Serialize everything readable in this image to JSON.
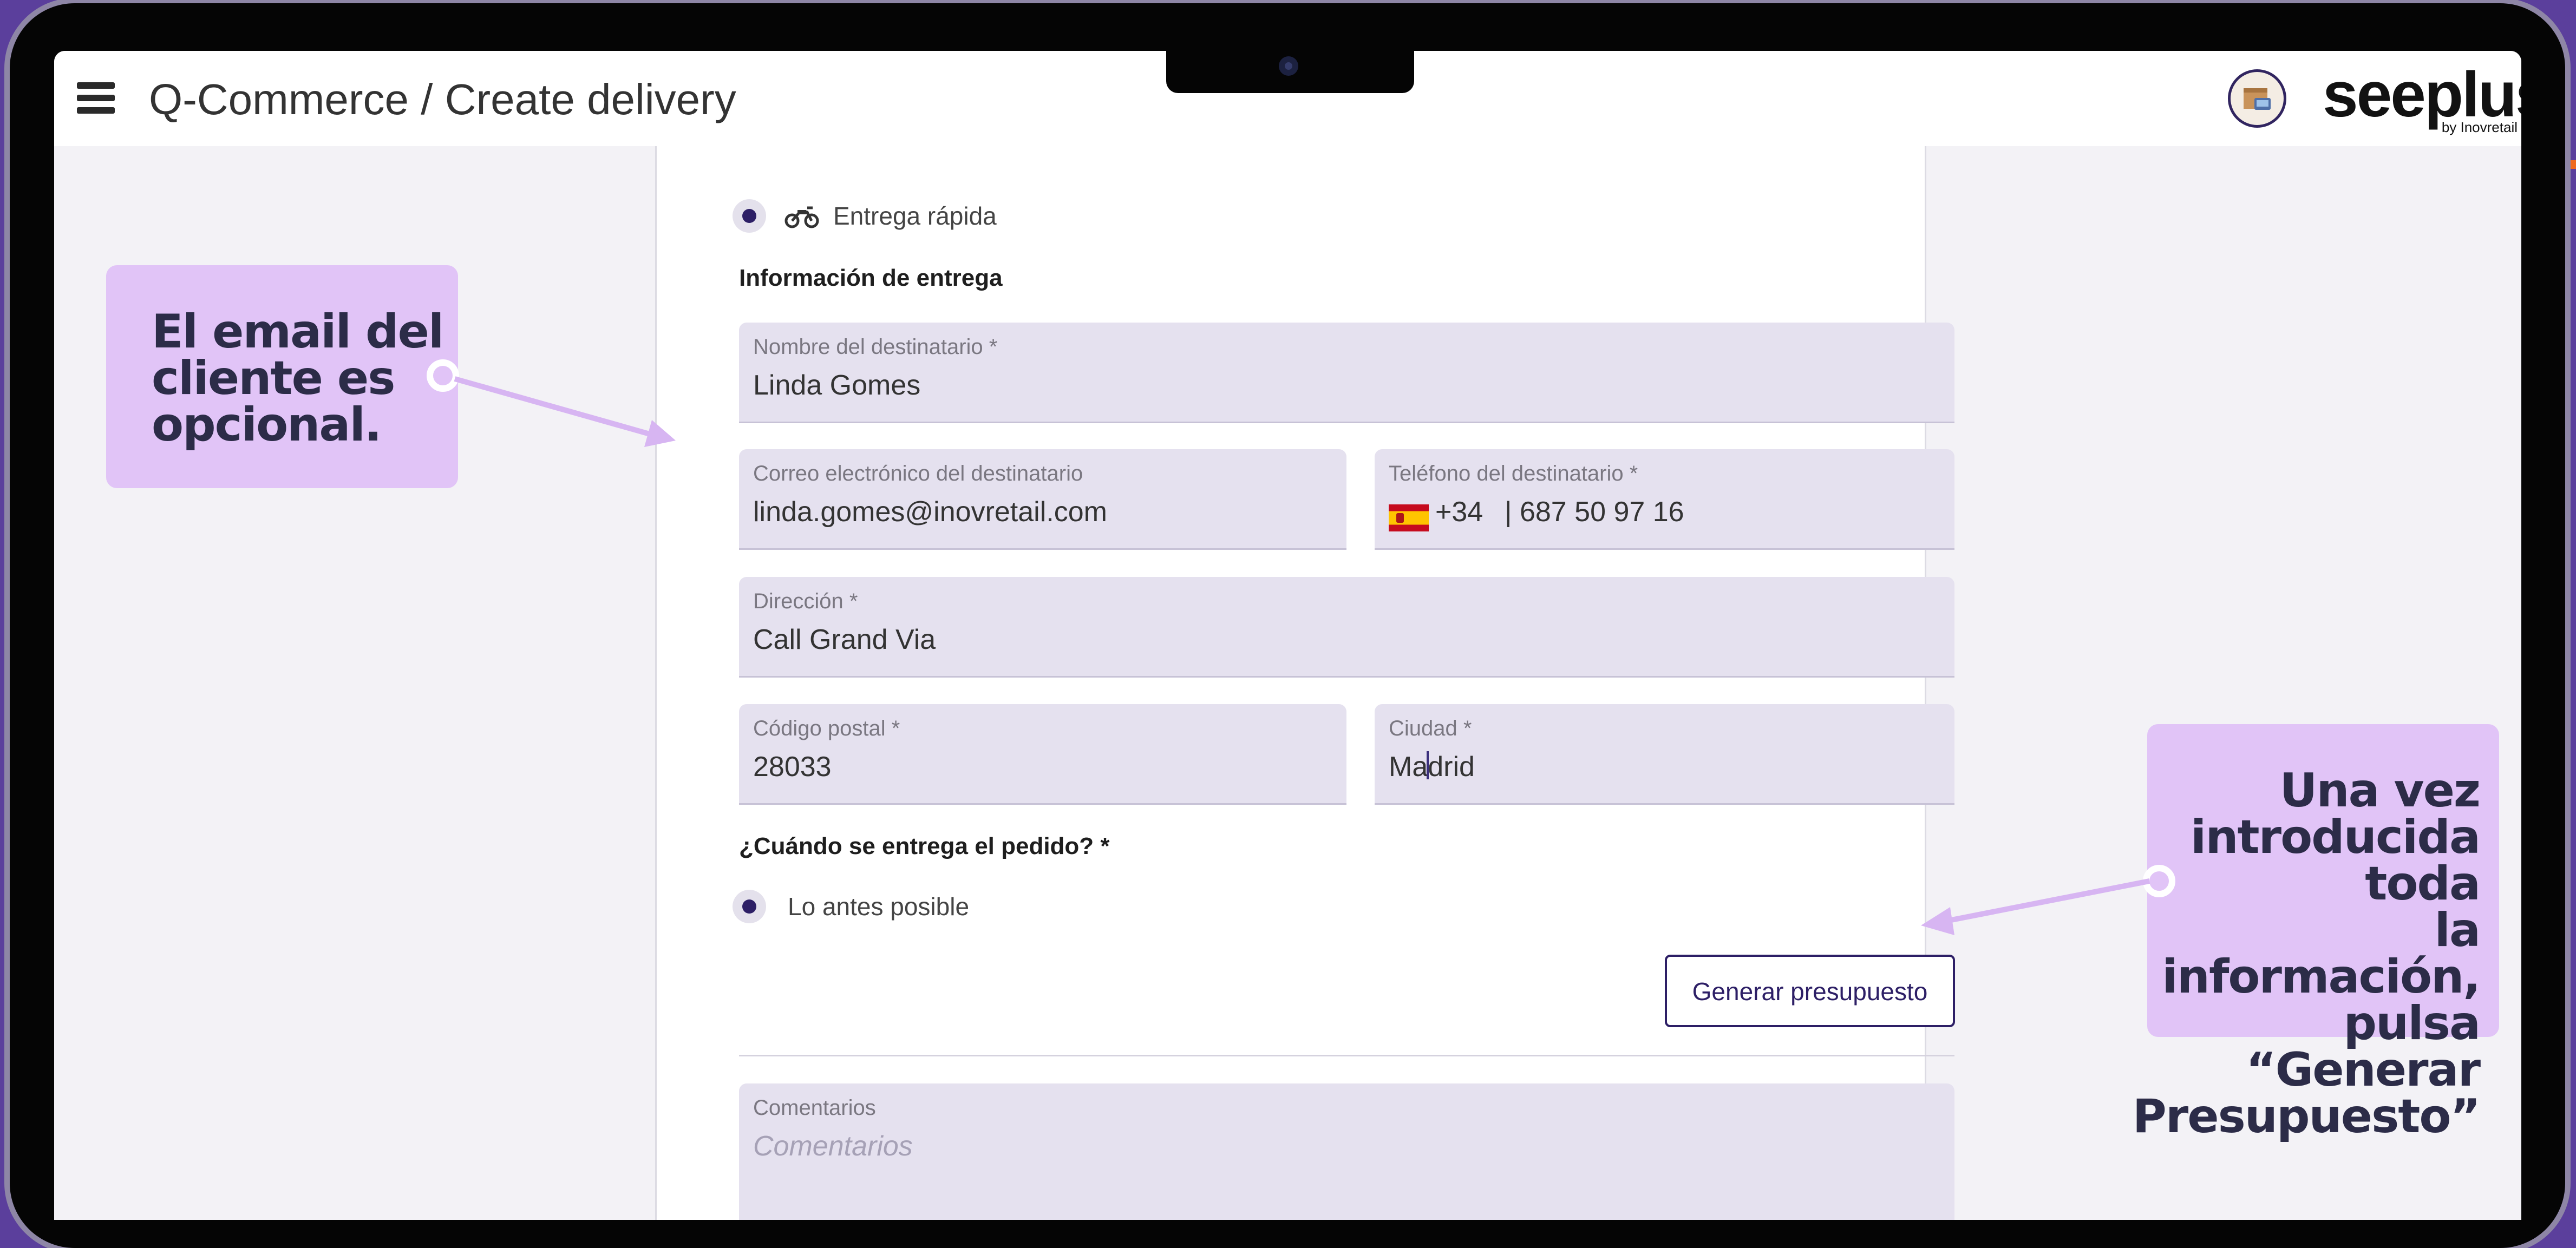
{
  "header": {
    "title": "Q-Commerce / Create delivery",
    "logo_text": "seeplus",
    "logo_subtext": "by Inovretail"
  },
  "form": {
    "delivery_type": {
      "label": "Entrega rápida",
      "selected": true
    },
    "section_delivery_info": "Información de entrega",
    "recipient_name": {
      "label": "Nombre del destinatario *",
      "value": "Linda Gomes"
    },
    "recipient_email": {
      "label": "Correo electrónico del destinatario",
      "value": "linda.gomes@inovretail.com"
    },
    "recipient_phone": {
      "label": "Teléfono del destinatario *",
      "country_code": "+34",
      "value": "| 687 50 97 16"
    },
    "address": {
      "label": "Dirección *",
      "value": "Call Grand Via"
    },
    "postal_code": {
      "label": "Código postal *",
      "value": "28033"
    },
    "city": {
      "label": "Ciudad *",
      "value_before_cursor": "Ma",
      "value_after_cursor": "drid"
    },
    "section_when": "¿Cuándo se entrega el pedido? *",
    "when_option": {
      "label": "Lo antes posible",
      "selected": true
    },
    "generate_button": "Generar presupuesto",
    "comments": {
      "label": "Comentarios",
      "placeholder": "Comentarios"
    }
  },
  "callouts": {
    "email_optional": [
      "El email del",
      "cliente es",
      "opcional."
    ],
    "generate_hint": [
      "Una vez",
      "introducida toda",
      "la información,",
      "pulsa “Generar",
      "Presupuesto”"
    ]
  },
  "colors": {
    "background": "#5b3f9c",
    "accent": "#2d1f66",
    "field_fill": "#e5e1ef",
    "callout_fill": "#e1c4f7"
  }
}
